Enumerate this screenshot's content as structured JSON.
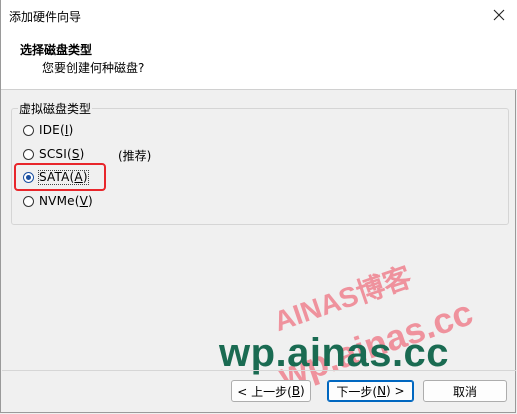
{
  "window": {
    "title": "添加硬件向导"
  },
  "header": {
    "title": "选择磁盘类型",
    "subtitle": "您要创建何种磁盘?"
  },
  "group": {
    "legend": "虚拟磁盘类型",
    "options": [
      {
        "text": "IDE(",
        "key": "I",
        "end": ")",
        "selected": false
      },
      {
        "text": "SCSI(",
        "key": "S",
        "end": ")",
        "selected": false,
        "note": "(推荐)"
      },
      {
        "text": "SATA(",
        "key": "A",
        "end": ")",
        "selected": true
      },
      {
        "text": "NVMe(",
        "key": "V",
        "end": ")",
        "selected": false
      }
    ]
  },
  "watermark": {
    "line1": "AINAS博客",
    "line2": "wp.ainas.cc",
    "line3": "wp.ainas.cc"
  },
  "buttons": {
    "back": {
      "pre": "< 上一步(",
      "key": "B",
      "post": ")"
    },
    "next": {
      "pre": "下一步(",
      "key": "N",
      "post": ") >"
    },
    "cancel": "取消"
  },
  "colors": {
    "highlight": "#e8262b",
    "accent": "#0067c0",
    "watermark_green": "#1a6b52",
    "watermark_pink": "#ee465a"
  }
}
